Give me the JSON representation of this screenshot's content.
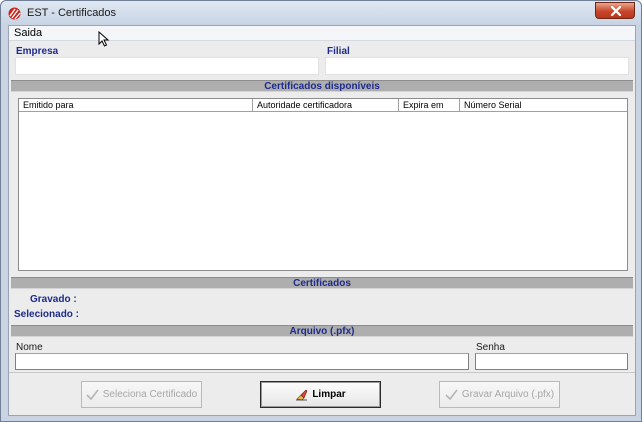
{
  "window": {
    "title": "EST - Certificados",
    "close_icon": "close-icon",
    "app_icon": "app-logo-icon"
  },
  "menu": {
    "items": [
      {
        "label": "Saida"
      }
    ]
  },
  "company": {
    "empresa_label": "Empresa",
    "empresa_value": "",
    "filial_label": "Filial",
    "filial_value": ""
  },
  "available": {
    "section_title": "Certificados disponíveis",
    "columns": [
      "Emitido para",
      "Autoridade certificadora",
      "Expira em",
      "Número Serial"
    ],
    "rows": []
  },
  "certificados": {
    "section_title": "Certificados",
    "gravado_label": "Gravado :",
    "gravado_value": "",
    "selecionado_label": "Selecionado :",
    "selecionado_value": ""
  },
  "arquivo": {
    "section_title": "Arquivo (.pfx)",
    "nome_label": "Nome",
    "nome_value": "",
    "senha_label": "Senha",
    "senha_value": ""
  },
  "buttons": {
    "seleciona_label": "Seleciona Certificado",
    "limpar_label": "Limpar",
    "gravar_label": "Gravar Arquivo (.pfx)"
  },
  "colors": {
    "label_blue": "#1c2b8c",
    "section_gray": "#aeaeae",
    "close_red": "#c7462a"
  }
}
